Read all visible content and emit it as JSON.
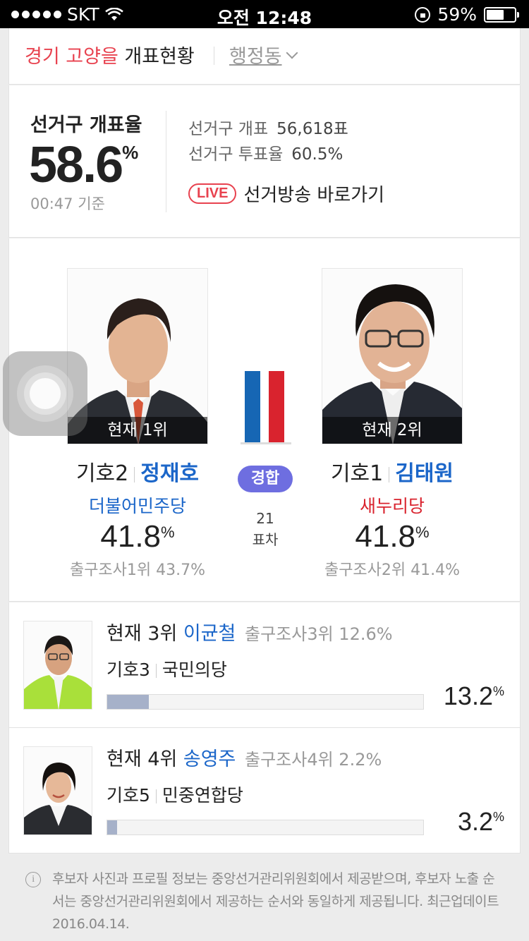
{
  "status_bar": {
    "carrier": "SKT",
    "time": "오전 12:48",
    "battery": "59%",
    "battery_level": 0.59
  },
  "header": {
    "region": "경기 고양을",
    "title": "개표현황",
    "dong_label": "행정동"
  },
  "summary": {
    "rate_label": "선거구 개표율",
    "rate_value": "58.6",
    "rate_unit": "%",
    "rate_time": "00:47 기준",
    "count_label": "선거구 개표",
    "count_value": "56,618표",
    "turnout_label": "선거구 투표율",
    "turnout_value": "60.5%",
    "live_badge": "LIVE",
    "live_link": "선거방송 바로가기"
  },
  "duel": {
    "status_badge": "경합",
    "gap_value": "21",
    "gap_label": "표차",
    "colors": {
      "first": "#1666b4",
      "second": "#d9232e"
    },
    "first": {
      "rank": "현재 1위",
      "number": "기호2",
      "name": "정재호",
      "party": "더불어민주당",
      "party_color": "#1b66c9",
      "pct": "41.8",
      "unit": "%",
      "exit_poll": "출구조사1위 43.7%"
    },
    "second": {
      "rank": "현재 2위",
      "number": "기호1",
      "name": "김태원",
      "party": "새누리당",
      "party_color": "#d9232e",
      "pct": "41.8",
      "unit": "%",
      "exit_poll": "출구조사2위 41.4%"
    }
  },
  "others": [
    {
      "rank": "현재 3위",
      "name": "이균철",
      "exit_poll": "출구조사3위 12.6%",
      "number": "기호3",
      "party": "국민의당",
      "pct": "13.2",
      "unit": "%",
      "share": 13.2
    },
    {
      "rank": "현재 4위",
      "name": "송영주",
      "exit_poll": "출구조사4위 2.2%",
      "number": "기호5",
      "party": "민중연합당",
      "pct": "3.2",
      "unit": "%",
      "share": 3.2
    }
  ],
  "notice": "후보자 사진과 프로필 정보는 중앙선거관리위원회에서 제공받으며, 후보자 노출 순서는 중앙선거관리위원회에서 제공하는 순서와 동일하게 제공됩니다. 최근업데이트 2016.04.14."
}
